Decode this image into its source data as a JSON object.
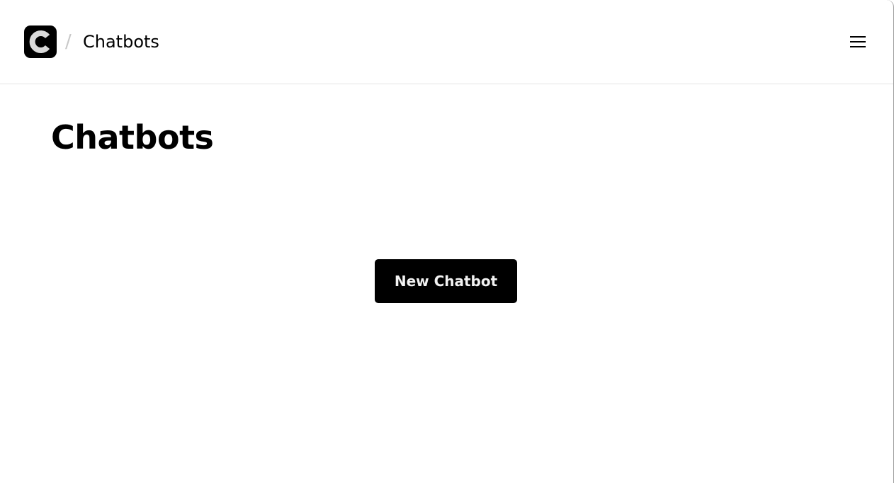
{
  "header": {
    "logo_icon": "app-logo-c",
    "breadcrumb_separator": "/",
    "breadcrumb_title": "Chatbots",
    "menu_icon": "hamburger-menu-icon"
  },
  "main": {
    "page_title": "Chatbots",
    "new_chatbot_label": "New Chatbot"
  },
  "colors": {
    "primary": "#000000",
    "background": "#ffffff",
    "button_text": "#f2f2f2",
    "divider": "#e3e3e3"
  }
}
